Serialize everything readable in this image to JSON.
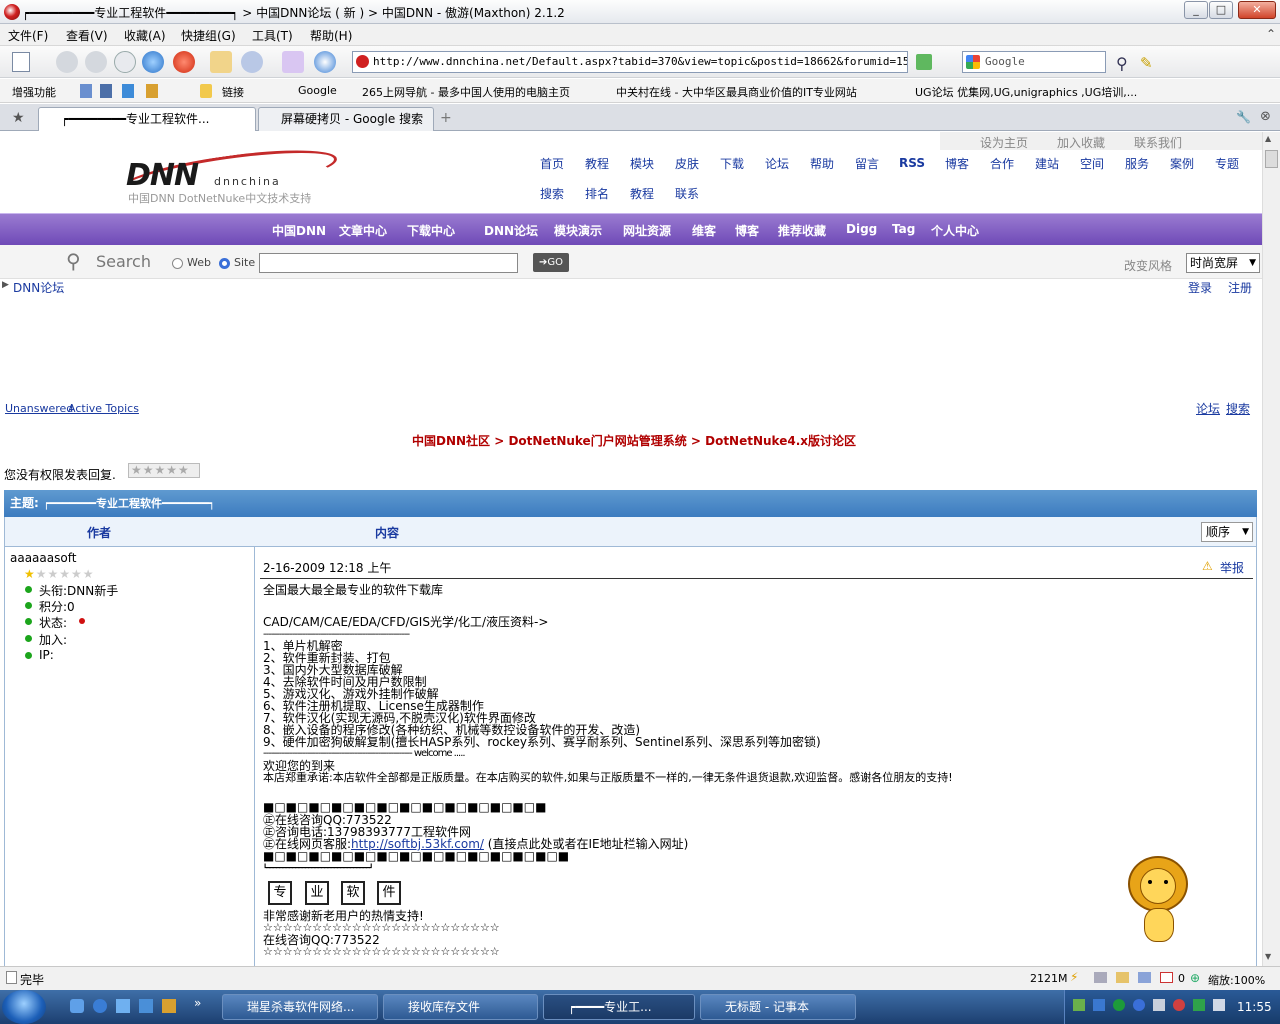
{
  "window": {
    "title": "┍━━━━━━━━━专业工程软件━━━━━━━━━┑ > 中国DNN论坛 ( 新 ) > 中国DNN - 傲游(Maxthon) 2.1.2",
    "minimize": "_",
    "maximize": "□",
    "close": "✕"
  },
  "menu": [
    "文件(F)",
    "查看(V)",
    "收藏(A)",
    "快捷组(G)",
    "工具(T)",
    "帮助(H)"
  ],
  "address": {
    "url": "http://www.dnnchina.net/Default.aspx?tabid=370&view=topic&postid=18662&forumid=15",
    "search_placeholder": "Google"
  },
  "links_bar": {
    "label": "增强功能",
    "links_label": "链接",
    "items": [
      "Google",
      "265上网导航 - 最多中国人使用的电脑主页",
      "中关村在线 - 大中华区最具商业价值的IT专业网站",
      "UG论坛 优集网,UG,unigraphics ,UG培训,..."
    ]
  },
  "tabs": [
    {
      "label": "┍━━━━━━━━专业工程软件..."
    },
    {
      "label": "屏幕硬拷贝 - Google 搜索"
    }
  ],
  "site": {
    "top_links": [
      "设为主页",
      "加入收藏",
      "联系我们"
    ],
    "logo_text": "DNN",
    "logo_sub": "dnnchina",
    "tagline": "中国DNN  DotNetNuke中文技术支持",
    "nav_row1": [
      "首页",
      "教程",
      "模块",
      "皮肤",
      "下载",
      "论坛",
      "帮助",
      "留言",
      "RSS",
      "博客",
      "合作",
      "建站",
      "空间",
      "服务",
      "案例",
      "专题"
    ],
    "nav_row2": [
      "搜索",
      "排名",
      "教程",
      "联系"
    ],
    "main_nav": [
      "中国DNN",
      "文章中心",
      "下载中心",
      "DNN论坛",
      "模块演示",
      "网址资源",
      "维客",
      "博客",
      "推荐收藏",
      "Digg",
      "Tag",
      "个人中心"
    ],
    "search": {
      "label": "Search",
      "opt_web": "Web",
      "opt_site": "Site",
      "go": "GO",
      "style_label": "改变风格",
      "style_value": "时尚宽屏"
    },
    "breadcrumb_forum": "DNN论坛",
    "login": "登录",
    "register": "注册"
  },
  "forum": {
    "unanswered": "Unanswered",
    "active_topics": "Active Topics",
    "forum_link": "论坛",
    "search_link": "搜索",
    "path": "中国DNN社区 > DotNetNuke门户网站管理系统 > DotNetNuke4.x版讨论区",
    "no_permission": "您没有权限发表回复.",
    "topic_label": "主题:",
    "topic_title": "┍━━━━━━━专业工程软件━━━━━━━┑",
    "col_author": "作者",
    "col_content": "内容",
    "sort": "顺序",
    "author": {
      "name": "aaaaaasoft",
      "title": "头衔:DNN新手",
      "points": "积分:0",
      "status": "状态:",
      "joined": "加入:",
      "ip": "IP:"
    },
    "post": {
      "date": "2-16-2009 12:18 上午",
      "report": "举报",
      "lines": [
        "全国最大最全最专业的软件下载库",
        "",
        "CAD/CAM/CAE/EDA/CFD/GIS光学/化工/液压资料->",
        "--------------------------------------------------------",
        "1、单片机解密",
        "2、软件重新封装、打包",
        "3、国内外大型数据库破解",
        "4、去除软件时间及用户数限制",
        "5、游戏汉化、游戏外挂制作破解",
        "6、软件注册机提取、License生成器制作",
        "7、软件汉化(实现无源码,不脱壳汉化)软件界面修改",
        "8、嵌入设备的程序修改(各种纺织、机械等数控设备软件的开发、改造)",
        "9、硬件加密狗破解复制(擅长HASP系列、rockey系列、赛孚耐系列、Sentinel系列、深思系列等加密锁)",
        "--------------------------------------------------------- welcome .....",
        "欢迎您的到来",
        "本店郑重承诺:本店软件全部都是正版质量。在本店购买的软件,如果与正版质量不一样的,一律无条件退货退款,欢迎监督。感谢各位朋友的支持!",
        "",
        "■□■□■□■□■□■□■□■□■□■□■□■□■",
        "㊣在线咨询QQ:773522",
        "㊣咨询电话:13798393777工程软件网",
        "㊣在线网页客服:",
        "■□■□■□■□■□■□■□■□■□■□■□■□■□■",
        "┗━━━━━━━━━━━━━━━━━━━━━━━━━━━━━━━━┛"
      ],
      "kf_url": "http://softbj.53kf.com/",
      "kf_note": "(直接点此处或者在IE地址栏输入网址)",
      "boxes": [
        "专",
        "业",
        "软",
        "件"
      ],
      "tail": [
        "非常感谢新老用户的热情支持!",
        "☆☆☆☆☆☆☆☆☆☆☆☆☆☆☆☆☆☆☆☆☆☆☆☆",
        "在线咨询QQ:773522",
        "☆☆☆☆☆☆☆☆☆☆☆☆☆☆☆☆☆☆☆☆☆☆☆☆"
      ]
    }
  },
  "status": {
    "text": "完毕",
    "memory": "2121M",
    "count": "0",
    "zoom": "缩放:100%"
  },
  "taskbar": {
    "buttons": [
      "瑞星杀毒软件网络...",
      "接收库存文件",
      "┍━━━━专业工...",
      "无标题 - 记事本"
    ],
    "clock": "11:55"
  },
  "colors": {
    "purple": "#7b56c0",
    "forum_blue": "#4a86c6",
    "link": "#1a3aa0",
    "path_red": "#b00000"
  }
}
